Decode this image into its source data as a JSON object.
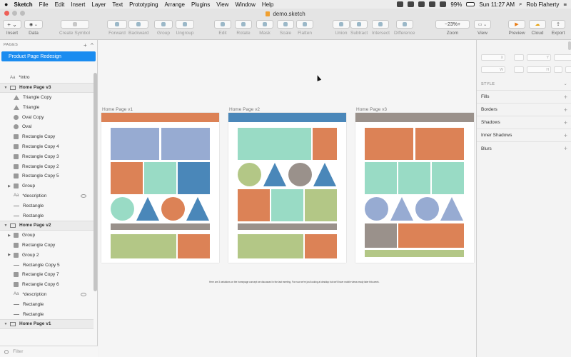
{
  "menubar": {
    "app_name": "Sketch",
    "items": [
      "File",
      "Edit",
      "Insert",
      "Layer",
      "Text",
      "Prototyping",
      "Arrange",
      "Plugins",
      "View",
      "Window",
      "Help"
    ],
    "battery": "99%",
    "clock": "Sun 11:27 AM",
    "user": "Rob Flaherty"
  },
  "window": {
    "title": "demo.sketch"
  },
  "toolbar": {
    "insert_label": "Insert",
    "data_label": "Data",
    "create_symbol_label": "Create Symbol",
    "forward_label": "Forward",
    "backward_label": "Backward",
    "group_label": "Group",
    "ungroup_label": "Ungroup",
    "edit_label": "Edit",
    "rotate_label": "Rotate",
    "mask_label": "Mask",
    "scale_label": "Scale",
    "flatten_label": "Flatten",
    "union_label": "Union",
    "subtract_label": "Subtract",
    "intersect_label": "Intersect",
    "difference_label": "Difference",
    "zoom_label": "Zoom",
    "zoom_value": "23%",
    "zoom_minus": "−",
    "zoom_plus": "+",
    "view_label": "View",
    "preview_label": "Preview",
    "cloud_label": "Cloud",
    "export_label": "Export"
  },
  "left": {
    "pages_header": "PAGES",
    "add": "+",
    "collapse": "^",
    "selected_page": "Product Page Redesign",
    "filter_placeholder": "Filter",
    "layers": [
      {
        "icon": "text",
        "label": "*intro",
        "indent": 0,
        "type": "layer"
      },
      {
        "icon": "artboard",
        "label": "Home Page v3",
        "indent": 0,
        "type": "artboard"
      },
      {
        "icon": "triangle",
        "label": "Triangle Copy",
        "indent": 1,
        "type": "layer"
      },
      {
        "icon": "triangle",
        "label": "Triangle",
        "indent": 1,
        "type": "layer"
      },
      {
        "icon": "oval",
        "label": "Oval Copy",
        "indent": 1,
        "type": "layer"
      },
      {
        "icon": "oval",
        "label": "Oval",
        "indent": 1,
        "type": "layer"
      },
      {
        "icon": "rect",
        "label": "Rectangle Copy",
        "indent": 1,
        "type": "layer"
      },
      {
        "icon": "rect",
        "label": "Rectangle Copy 4",
        "indent": 1,
        "type": "layer"
      },
      {
        "icon": "rect",
        "label": "Rectangle Copy 3",
        "indent": 1,
        "type": "layer"
      },
      {
        "icon": "rect",
        "label": "Rectangle Copy 2",
        "indent": 1,
        "type": "layer"
      },
      {
        "icon": "rect",
        "label": "Rectangle Copy 5",
        "indent": 1,
        "type": "layer"
      },
      {
        "icon": "folder",
        "label": "Group",
        "indent": 1,
        "type": "group"
      },
      {
        "icon": "text",
        "label": "*description",
        "indent": 1,
        "type": "layer",
        "hidden": true
      },
      {
        "icon": "line",
        "label": "Rectangle",
        "indent": 1,
        "type": "layer"
      },
      {
        "icon": "line",
        "label": "Rectangle",
        "indent": 1,
        "type": "layer"
      },
      {
        "icon": "artboard",
        "label": "Home Page v2",
        "indent": 0,
        "type": "artboard"
      },
      {
        "icon": "folder",
        "label": "Group",
        "indent": 1,
        "type": "group"
      },
      {
        "icon": "rect",
        "label": "Rectangle Copy",
        "indent": 1,
        "type": "layer"
      },
      {
        "icon": "folder",
        "label": "Group 2",
        "indent": 1,
        "type": "group"
      },
      {
        "icon": "line",
        "label": "Rectangle Copy 5",
        "indent": 1,
        "type": "layer"
      },
      {
        "icon": "rect",
        "label": "Rectangle Copy 7",
        "indent": 1,
        "type": "layer"
      },
      {
        "icon": "rect",
        "label": "Rectangle Copy 6",
        "indent": 1,
        "type": "layer"
      },
      {
        "icon": "text",
        "label": "*description",
        "indent": 1,
        "type": "layer",
        "hidden": true
      },
      {
        "icon": "line",
        "label": "Rectangle",
        "indent": 1,
        "type": "layer"
      },
      {
        "icon": "line",
        "label": "Rectangle",
        "indent": 1,
        "type": "layer"
      },
      {
        "icon": "artboard",
        "label": "Home Page v1",
        "indent": 0,
        "type": "artboard"
      }
    ]
  },
  "canvas": {
    "artboards": [
      {
        "label": "Home Page v1"
      },
      {
        "label": "Home Page v2"
      },
      {
        "label": "Home Page v3"
      }
    ],
    "caption": "Here are 3 variations on the homepage concept we discussed in the last meeting. For now we're just looking at desktop but we'll have mobile views ready later this week."
  },
  "right": {
    "x_label": "X",
    "y_label": "Y",
    "w_label": "W",
    "h_label": "H",
    "style_header": "STYLE",
    "fills": "Fills",
    "borders": "Borders",
    "shadows": "Shadows",
    "inner_shadows": "Inner Shadows",
    "blurs": "Blurs",
    "plus": "+"
  },
  "colors": {
    "accent": "#1a8cf0",
    "orange": "#dc8256",
    "steel_blue": "#4a87b9",
    "lavender": "#97abd2",
    "mint": "#99dbc5",
    "olive": "#b3c786",
    "gray": "#9a918b"
  }
}
